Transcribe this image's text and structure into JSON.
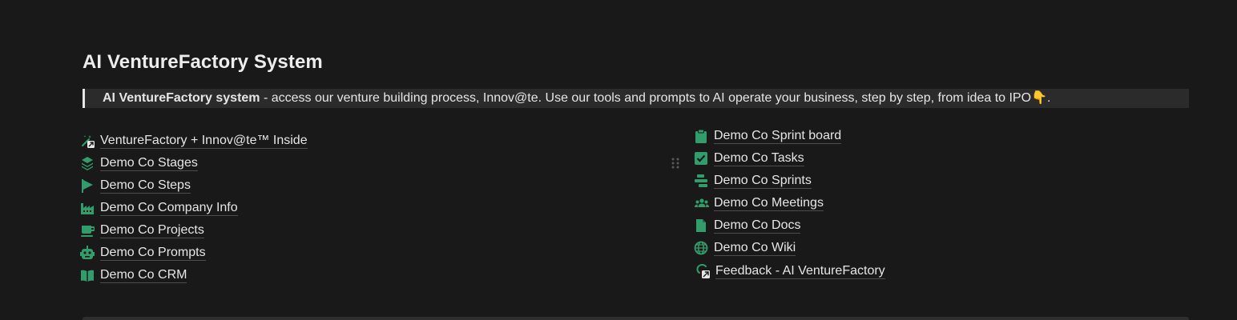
{
  "title": "AI VentureFactory System",
  "callout": {
    "bold": "AI VentureFactory system",
    "text": " - access our venture building process, Innov@te. Use our tools and prompts to AI operate your business, step by step, from idea to IPO",
    "emoji": "👇",
    "end": "."
  },
  "left_links": [
    {
      "label": "VentureFactory + Innov@te™ Inside",
      "icon": "magic-wand-link-icon"
    },
    {
      "label": "Demo Co Stages",
      "icon": "layers-icon"
    },
    {
      "label": "Demo Co Steps",
      "icon": "flag-icon"
    },
    {
      "label": "Demo Co Company Info",
      "icon": "factory-icon"
    },
    {
      "label": "Demo Co Projects",
      "icon": "coffee-cup-icon"
    },
    {
      "label": "Demo Co Prompts",
      "icon": "robot-icon"
    },
    {
      "label": "Demo Co CRM",
      "icon": "open-book-icon"
    }
  ],
  "right_links": [
    {
      "label": "Demo Co Sprint board",
      "icon": "clipboard-icon"
    },
    {
      "label": "Demo Co Tasks",
      "icon": "checkbox-icon"
    },
    {
      "label": "Demo Co Sprints",
      "icon": "timeline-icon"
    },
    {
      "label": "Demo Co Meetings",
      "icon": "people-icon"
    },
    {
      "label": "Demo Co Docs",
      "icon": "document-icon"
    },
    {
      "label": "Demo Co Wiki",
      "icon": "globe-icon"
    },
    {
      "label": "Feedback - AI VentureFactory",
      "icon": "feedback-link-icon"
    }
  ],
  "colors": {
    "accent_green": "#2f9e6b",
    "background": "#191919",
    "callout_bg": "#2b2b2b"
  }
}
